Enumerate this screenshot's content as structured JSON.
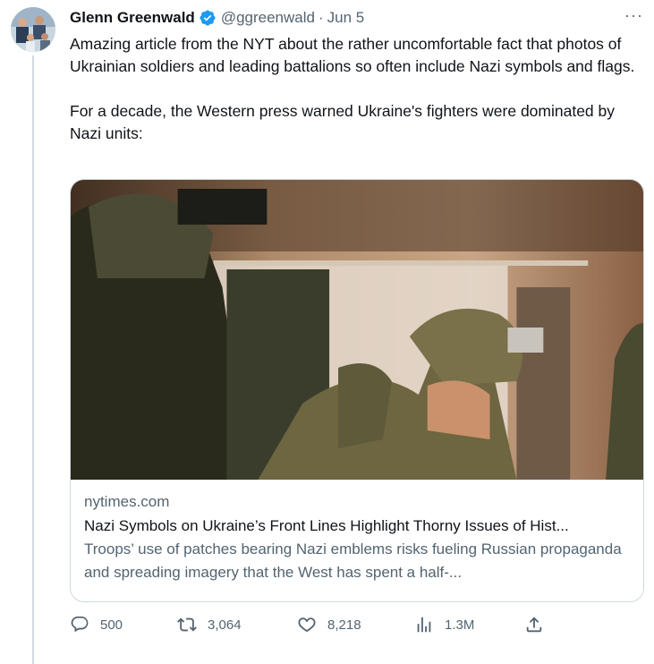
{
  "tweet": {
    "author_name": "Glenn Greenwald",
    "handle": "@ggreenwald",
    "separator": "·",
    "date": "Jun 5",
    "more": "···",
    "text": "Amazing article from the NYT about the rather uncomfortable fact that photos of Ukrainian soldiers and leading battalions so often include Nazi symbols and flags.\n\nFor a decade, the Western press warned Ukraine's fighters were dominated by Nazi units:"
  },
  "card": {
    "domain": "nytimes.com",
    "title": "Nazi Symbols on Ukraine’s Front Lines Highlight Thorny Issues of Hist...",
    "description": "Troops’ use of patches bearing Nazi emblems risks fueling Russian propaganda and spreading imagery that the West has spent a half-..."
  },
  "actions": {
    "replies": "500",
    "retweets": "3,064",
    "likes": "8,218",
    "views": "1.3M"
  },
  "colors": {
    "verified": "#1d9bf0",
    "secondary_text": "#536471",
    "border": "#cfd9de"
  }
}
